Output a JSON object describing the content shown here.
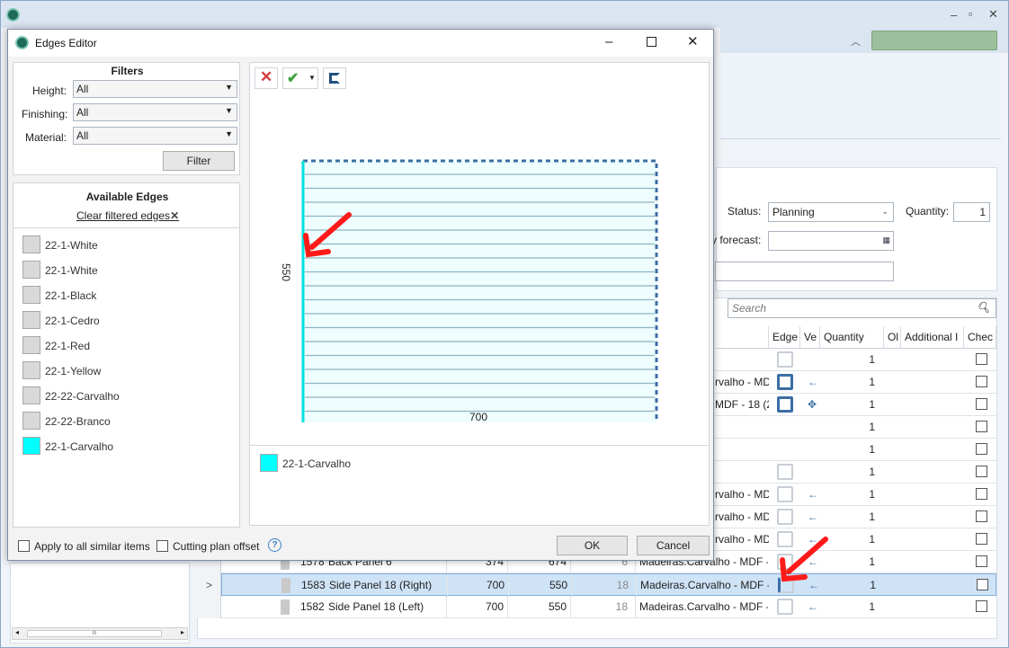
{
  "main": {
    "status_label": "Status:",
    "status_value": "Planning",
    "quantity_label": "Quantity:",
    "quantity_value": "1",
    "forecast_label": "y forecast:",
    "search_placeholder": "Search",
    "columns": [
      "Edge",
      "Ve",
      "Quantity",
      "Ol",
      "Additional I",
      "Chec"
    ],
    "partial_rows": [
      {
        "material": "",
        "qty": "1",
        "edge": "grey",
        "arrow": ""
      },
      {
        "material": "rvalho - MDF -",
        "qty": "1",
        "edge": "blue",
        "arrow": "←"
      },
      {
        "material": "MDF - 18 (2",
        "qty": "1",
        "edge": "blue",
        "arrow": "✥"
      },
      {
        "material": "",
        "qty": "1",
        "edge": "",
        "arrow": ""
      },
      {
        "material": "",
        "qty": "1",
        "edge": "",
        "arrow": ""
      },
      {
        "material": "",
        "qty": "1",
        "edge": "grey",
        "arrow": ""
      },
      {
        "material": "rvalho - MDF -",
        "qty": "1",
        "edge": "grey",
        "arrow": "←"
      },
      {
        "material": "rvalho - MDF -",
        "qty": "1",
        "edge": "grey",
        "arrow": "←"
      },
      {
        "material": "rvalho - MDF -",
        "qty": "1",
        "edge": "grey",
        "arrow": "←"
      }
    ],
    "rows": [
      {
        "id": "1578",
        "name": "Back Panel 6",
        "w": "374",
        "h": "674",
        "t": "6",
        "material": "Madeiras.Carvalho - MDF -",
        "qty": "1",
        "arrow": "←"
      },
      {
        "id": "1583",
        "name": "Side Panel 18 (Right)",
        "w": "700",
        "h": "550",
        "t": "18",
        "material": "Madeiras.Carvalho - MDF -",
        "qty": "1",
        "arrow": "←"
      },
      {
        "id": "1582",
        "name": "Side Panel 18 (Left)",
        "w": "700",
        "h": "550",
        "t": "18",
        "material": "Madeiras.Carvalho - MDF -",
        "qty": "1",
        "arrow": "←"
      }
    ],
    "row_pointer": ">",
    "scroll_thumb": "III"
  },
  "dialog": {
    "title": "Edges Editor",
    "filters": {
      "heading": "Filters",
      "height_label": "Height:",
      "height_value": "All",
      "finishing_label": "Finishing:",
      "finishing_value": "All",
      "material_label": "Material:",
      "material_value": "All",
      "filter_button": "Filter"
    },
    "available": {
      "heading": "Available Edges",
      "clear_link": "Clear filtered edges",
      "items": [
        {
          "label": "22-1-White",
          "color": "#d9d9d9"
        },
        {
          "label": "22-1-White",
          "color": "#d9d9d9"
        },
        {
          "label": "22-1-Black",
          "color": "#d9d9d9"
        },
        {
          "label": "22-1-Cedro",
          "color": "#d9d9d9"
        },
        {
          "label": "22-1-Red",
          "color": "#d9d9d9"
        },
        {
          "label": "22-1-Yellow",
          "color": "#d9d9d9"
        },
        {
          "label": "22-22-Carvalho",
          "color": "#d9d9d9"
        },
        {
          "label": "22-22-Branco",
          "color": "#d9d9d9"
        },
        {
          "label": "22-1-Carvalho",
          "color": "#00ffff"
        }
      ]
    },
    "panel": {
      "height_dim": "550",
      "width_dim": "700",
      "accent_edge_color": "#00e0e0"
    },
    "legend": {
      "label": "22-1-Carvalho",
      "color": "#00ffff"
    },
    "apply_similar_label": "Apply to all similar items",
    "cutting_offset_label": "Cutting plan offset",
    "ok_label": "OK",
    "cancel_label": "Cancel",
    "help_icon": "?"
  }
}
